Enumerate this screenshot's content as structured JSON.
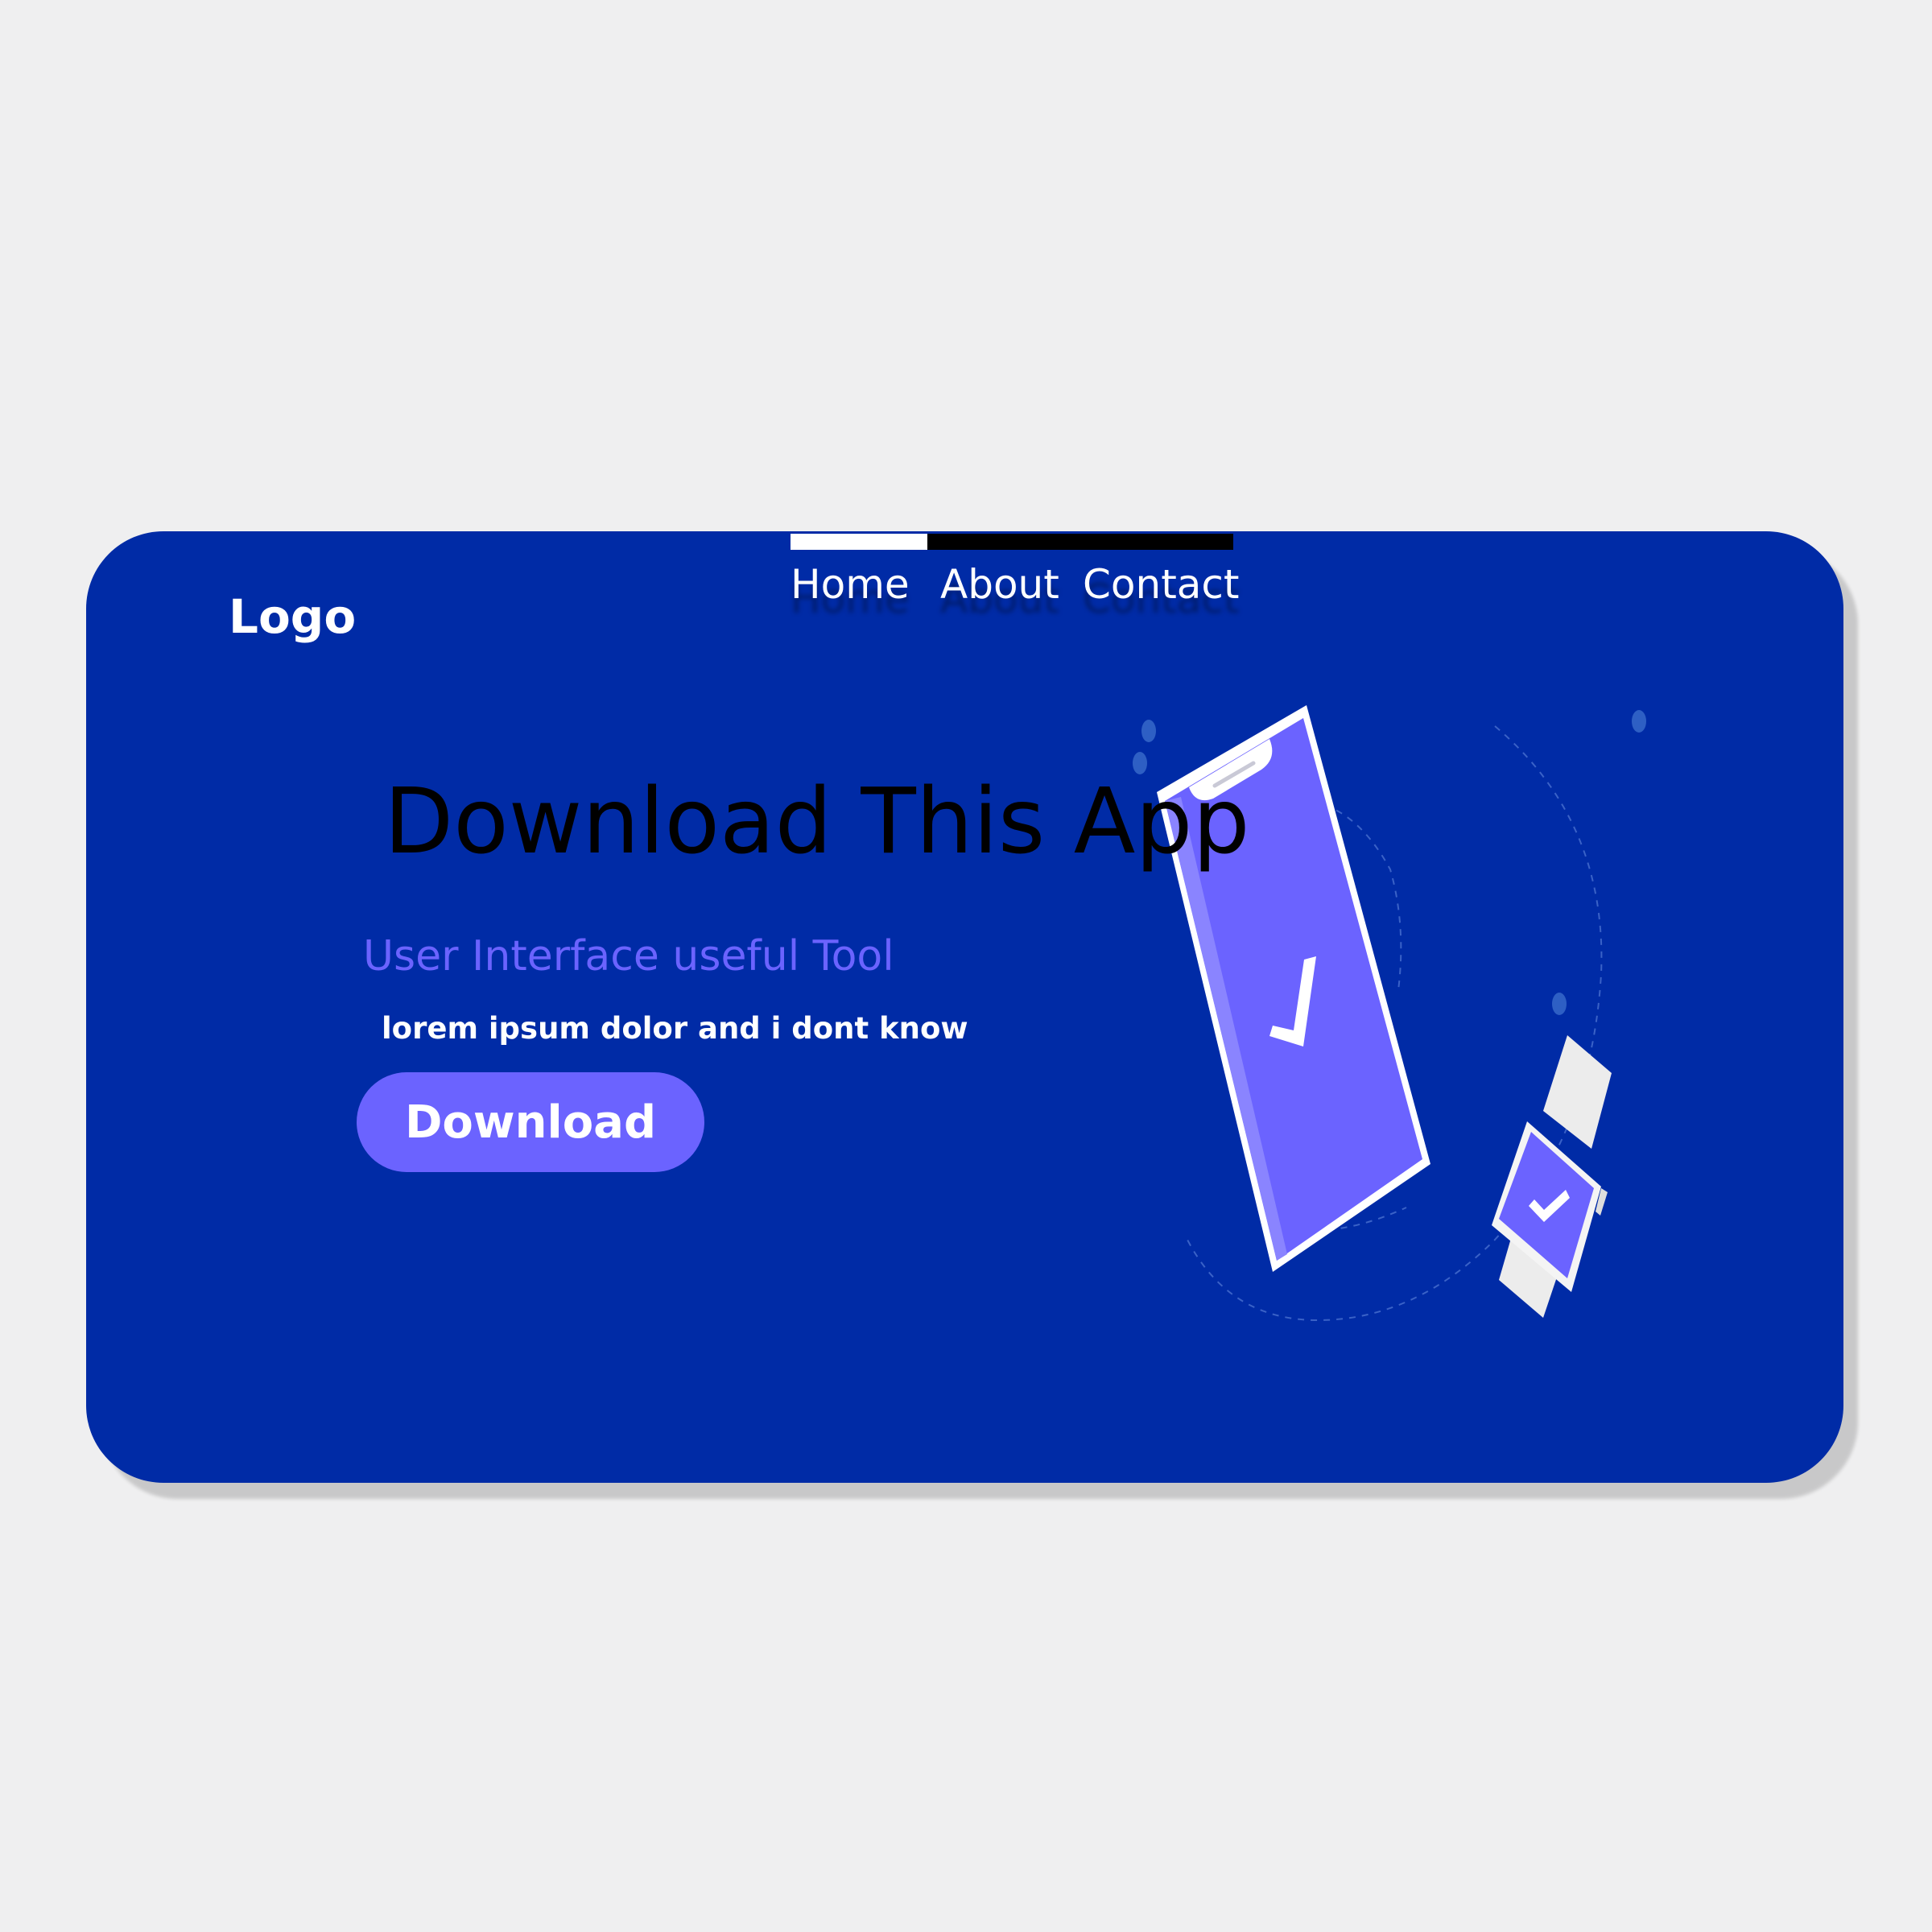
{
  "header": {
    "logo": "Logo",
    "nav": [
      {
        "label": "Home"
      },
      {
        "label": "About"
      },
      {
        "label": "Contact"
      }
    ]
  },
  "hero": {
    "title": "Download This App",
    "subtitle": "User Interface useful Tool",
    "text": "lorem ipsum dolor and i dont know",
    "button_label": "Download"
  },
  "colors": {
    "page_background": "#efeff0",
    "card_background": "#002ba6",
    "accent": "#6b63ff",
    "text_light": "#ffffff",
    "text_dark": "#000000"
  },
  "illustration": {
    "icons": [
      "smartphone-icon",
      "check-icon",
      "smartwatch-icon"
    ]
  }
}
